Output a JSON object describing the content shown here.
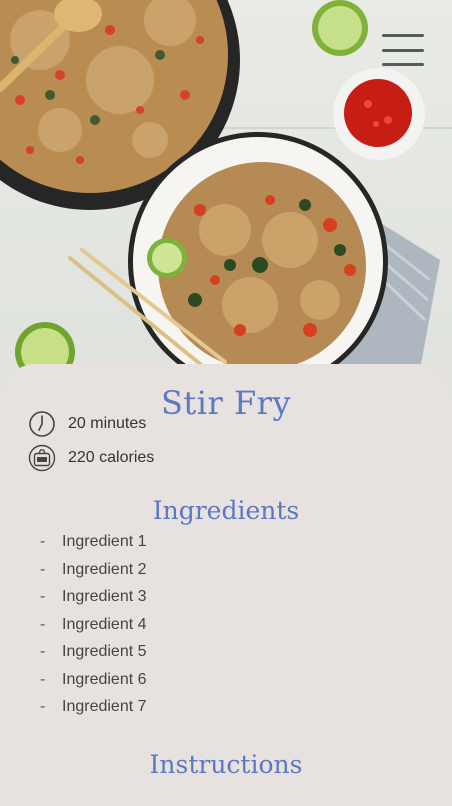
{
  "header": {
    "menu_icon": "hamburger-menu-icon",
    "image_subject": "stir-fry-photo"
  },
  "recipe": {
    "title": "Stir Fry",
    "time_icon": "clock-icon",
    "time": "20 minutes",
    "calories_icon": "kcal-scale-icon",
    "calories": "220 calories"
  },
  "ingredients": {
    "heading": "Ingredients",
    "bullet": "-",
    "items": [
      "Ingredient 1",
      "Ingredient 2",
      "Ingredient 3",
      "Ingredient 4",
      "Ingredient 5",
      "Ingredient 6",
      "Ingredient 7"
    ]
  },
  "instructions": {
    "heading": "Instructions"
  },
  "colors": {
    "accent": "#5b78c4",
    "card_background": "#e7e2e0",
    "text": "#444444"
  }
}
